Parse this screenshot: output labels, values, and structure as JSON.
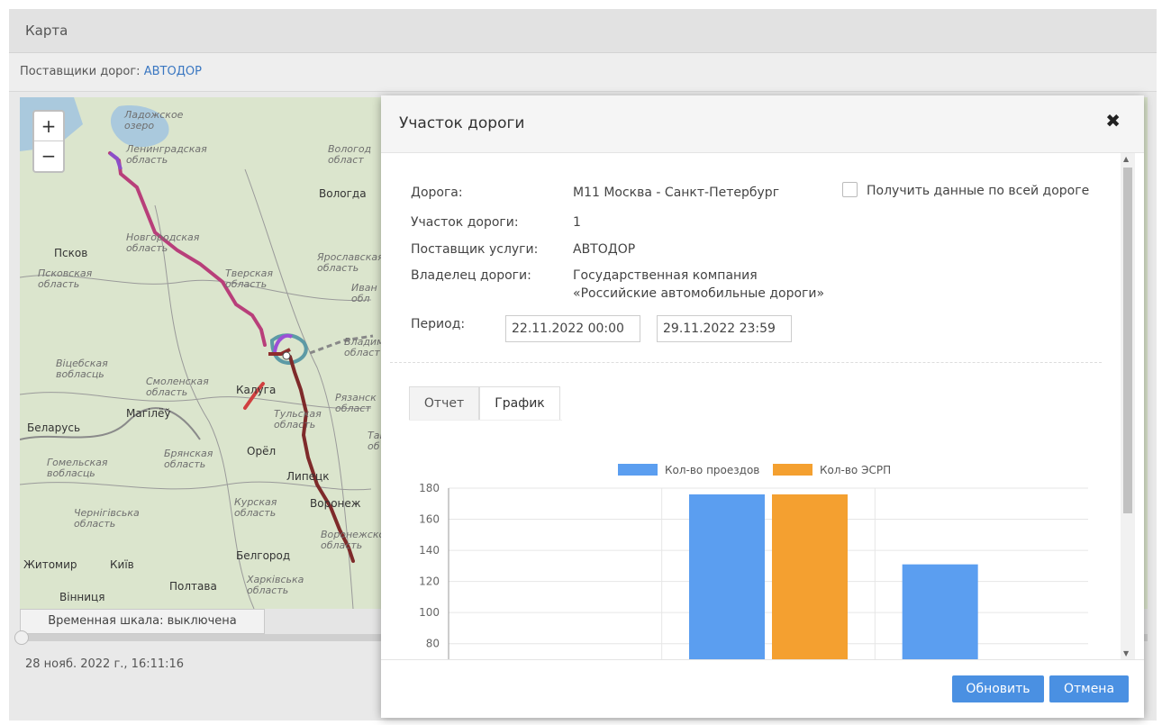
{
  "header": {
    "title": "Карта"
  },
  "providers": {
    "label": "Поставщики дорог:",
    "value": "АВТОДОР"
  },
  "map": {
    "zoom_in": "+",
    "zoom_out": "−",
    "labels": {
      "ladoga": "Ладожское\nозеро",
      "leningrad_obl": "Ленинградская\nобласть",
      "vologda_obl": "Вологод\nобласт",
      "vologda": "Вологда",
      "novgorod_obl": "Новгородская\nобласть",
      "pskov": "Псков",
      "pskov_obl": "Псковская\nобласть",
      "yaroslavl_obl": "Ярославская\nобласть",
      "tver_obl": "Тверская\nобласть",
      "ivan": "Иван\nобл",
      "vitebsk": "Віцебская\nвобласць",
      "smolensk_obl": "Смоленская\nобласть",
      "kaluga": "Калуга",
      "ryazan": "Рязанск\nобласт",
      "mogilev": "Магілёў",
      "belarus": "Беларусь",
      "tula_obl": "Тульская\nобласть",
      "bryansk_obl": "Брянская\nобласть",
      "orel": "Орёл",
      "gomel": "Гомельская\nвобласць",
      "lipetsk": "Липецк",
      "kursk_obl": "Курская\nобласть",
      "voronezh": "Воронеж",
      "chernigov": "Чернігівська\nобласть",
      "voronezh_obl": "Воронежско\nобласть",
      "zhitomir": "Житомир",
      "kiev": "Київ",
      "belgorod": "Белгород",
      "poltava": "Полтава",
      "vinnitsa": "Вінниця",
      "kharkov": "Харківська\nобласть",
      "vladimir": "Владими\nобласт",
      "tambov": "Там\nоб"
    }
  },
  "timeline": {
    "button_label": "Временная шкала: выключена",
    "timestamp": "28 нояб. 2022 г., 16:11:16"
  },
  "modal": {
    "title": "Участок дороги",
    "close": "✖",
    "fields": {
      "road_label": "Дорога:",
      "road_value": "М11 Москва - Санкт-Петербург",
      "segment_label": "Участок дороги:",
      "segment_value": "1",
      "provider_label": "Поставщик услуги:",
      "provider_value": "АВТОДОР",
      "owner_label": "Владелец дороги:",
      "owner_value_1": "Государственная компания",
      "owner_value_2": "«Российские автомобильные дороги»",
      "period_label": "Период:",
      "period_from": "22.11.2022 00:00",
      "period_to": "29.11.2022 23:59"
    },
    "checkbox_label": "Получить данные по всей дороге",
    "tabs": [
      {
        "label": "Отчет"
      },
      {
        "label": "График"
      }
    ],
    "buttons": {
      "refresh": "Обновить",
      "cancel": "Отмена"
    }
  },
  "colors": {
    "primary_button": "#4a90e2",
    "series_1": "#5b9ef0",
    "series_2": "#f4a030"
  },
  "chart_data": {
    "type": "bar",
    "series": [
      {
        "name": "Кол-во проездов",
        "values": [
          null,
          176,
          131
        ]
      },
      {
        "name": "Кол-во ЭСРП",
        "values": [
          null,
          176,
          null
        ]
      }
    ],
    "y_ticks": [
      80,
      100,
      120,
      140,
      160,
      180
    ],
    "ylim": [
      70,
      180
    ],
    "legend": "top-center",
    "grid": true
  }
}
